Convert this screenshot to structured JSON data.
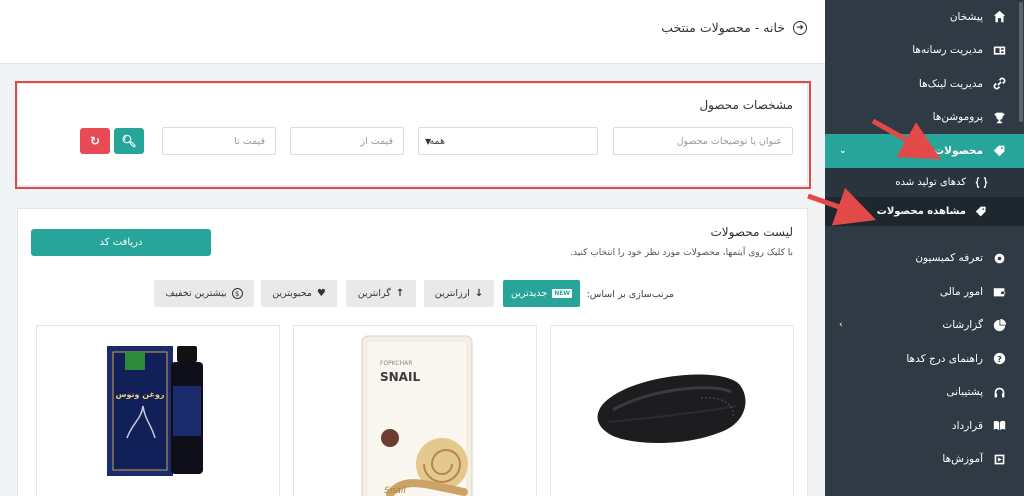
{
  "header": {
    "breadcrumb": "خانه - محصولات منتخب"
  },
  "sidebar": {
    "items": [
      {
        "label": "پیشخان",
        "icon": "home-icon"
      },
      {
        "label": "مدیریت رسانه‌ها",
        "icon": "media-icon"
      },
      {
        "label": "مدیریت لینک‌ها",
        "icon": "link-icon"
      },
      {
        "label": "پروموشن‌ها",
        "icon": "trophy-icon"
      },
      {
        "label": "محصولات",
        "icon": "tag-icon",
        "active": true
      },
      {
        "label": "تعرفه کمیسیون",
        "icon": "settings-icon"
      },
      {
        "label": "امور مالی",
        "icon": "wallet-icon"
      },
      {
        "label": "گزارشات",
        "icon": "pie-chart-icon"
      },
      {
        "label": "راهنمای درج کدها",
        "icon": "help-icon"
      },
      {
        "label": "پشتیبانی",
        "icon": "support-icon"
      },
      {
        "label": "قرارداد",
        "icon": "book-icon"
      },
      {
        "label": "آموزش‌ها",
        "icon": "video-icon"
      }
    ],
    "submenu": [
      {
        "label": "کدهای تولید شده",
        "icon": "code-icon"
      },
      {
        "label": "مشاهده محصولات",
        "icon": "tags-icon",
        "current": true
      }
    ]
  },
  "filter": {
    "title": "مشخصات محصول",
    "search_placeholder": "عنوان یا توضیحات محصول",
    "category_value": "همه",
    "price_from_placeholder": "قیمت از",
    "price_to_placeholder": "قیمت تا"
  },
  "products": {
    "title": "لیست محصولات",
    "hint": "با کلیک روی آیتمها، محصولات مورد نظر خود را انتخاب کنید.",
    "get_code_label": "دریافت کد",
    "sort_label": "مرتب‌سازی بر اساس:",
    "sort_options": [
      {
        "label": "جدیدترین",
        "icon": "new-badge",
        "badge": "NEW"
      },
      {
        "label": "ارزانترین",
        "icon": "arrow-down-icon"
      },
      {
        "label": "گرانترین",
        "icon": "arrow-up-icon"
      },
      {
        "label": "محبوبترین",
        "icon": "heart-icon"
      },
      {
        "label": "بیشترین تخفیف",
        "icon": "dollar-icon"
      }
    ],
    "card_texts": {
      "snail_brand": "FOPKCHAR",
      "snail_title": "SNAIL",
      "snail_script": "Snail",
      "oil_title": "روغن ونوس"
    }
  },
  "colors": {
    "accent": "#27a59a",
    "danger": "#e84b55",
    "sidebar_bg": "#2f3a44",
    "highlight": "#e24a4a"
  }
}
